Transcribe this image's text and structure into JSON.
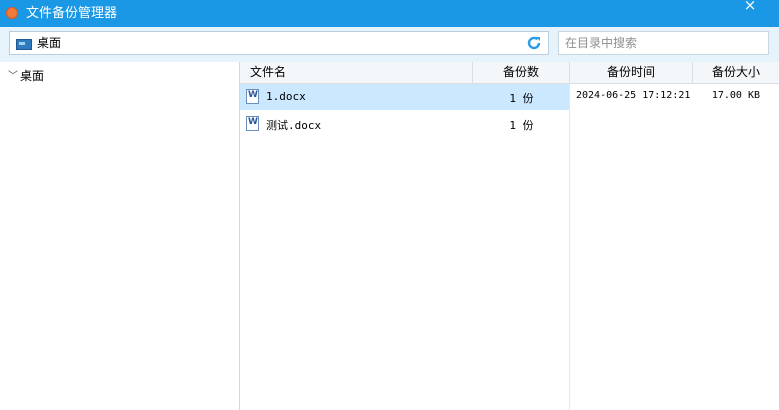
{
  "window": {
    "title": "文件备份管理器",
    "close_glyph": "×",
    "accent": "#1a98e6"
  },
  "toolbar": {
    "path": "桌面",
    "refresh_icon": "refresh-icon",
    "search_placeholder": "在目录中搜索"
  },
  "tree": {
    "items": [
      {
        "label": "桌面",
        "expanded": true
      }
    ]
  },
  "table": {
    "columns": [
      "文件名",
      "备份数",
      "备份时间",
      "备份大小"
    ],
    "rows": [
      {
        "name": "1.docx",
        "count": "1 份",
        "time": "2024-06-25 17:12:21",
        "size": "17.00 KB",
        "selected": true
      },
      {
        "name": "测试.docx",
        "count": "1 份",
        "time": "",
        "size": "",
        "selected": false
      }
    ]
  }
}
